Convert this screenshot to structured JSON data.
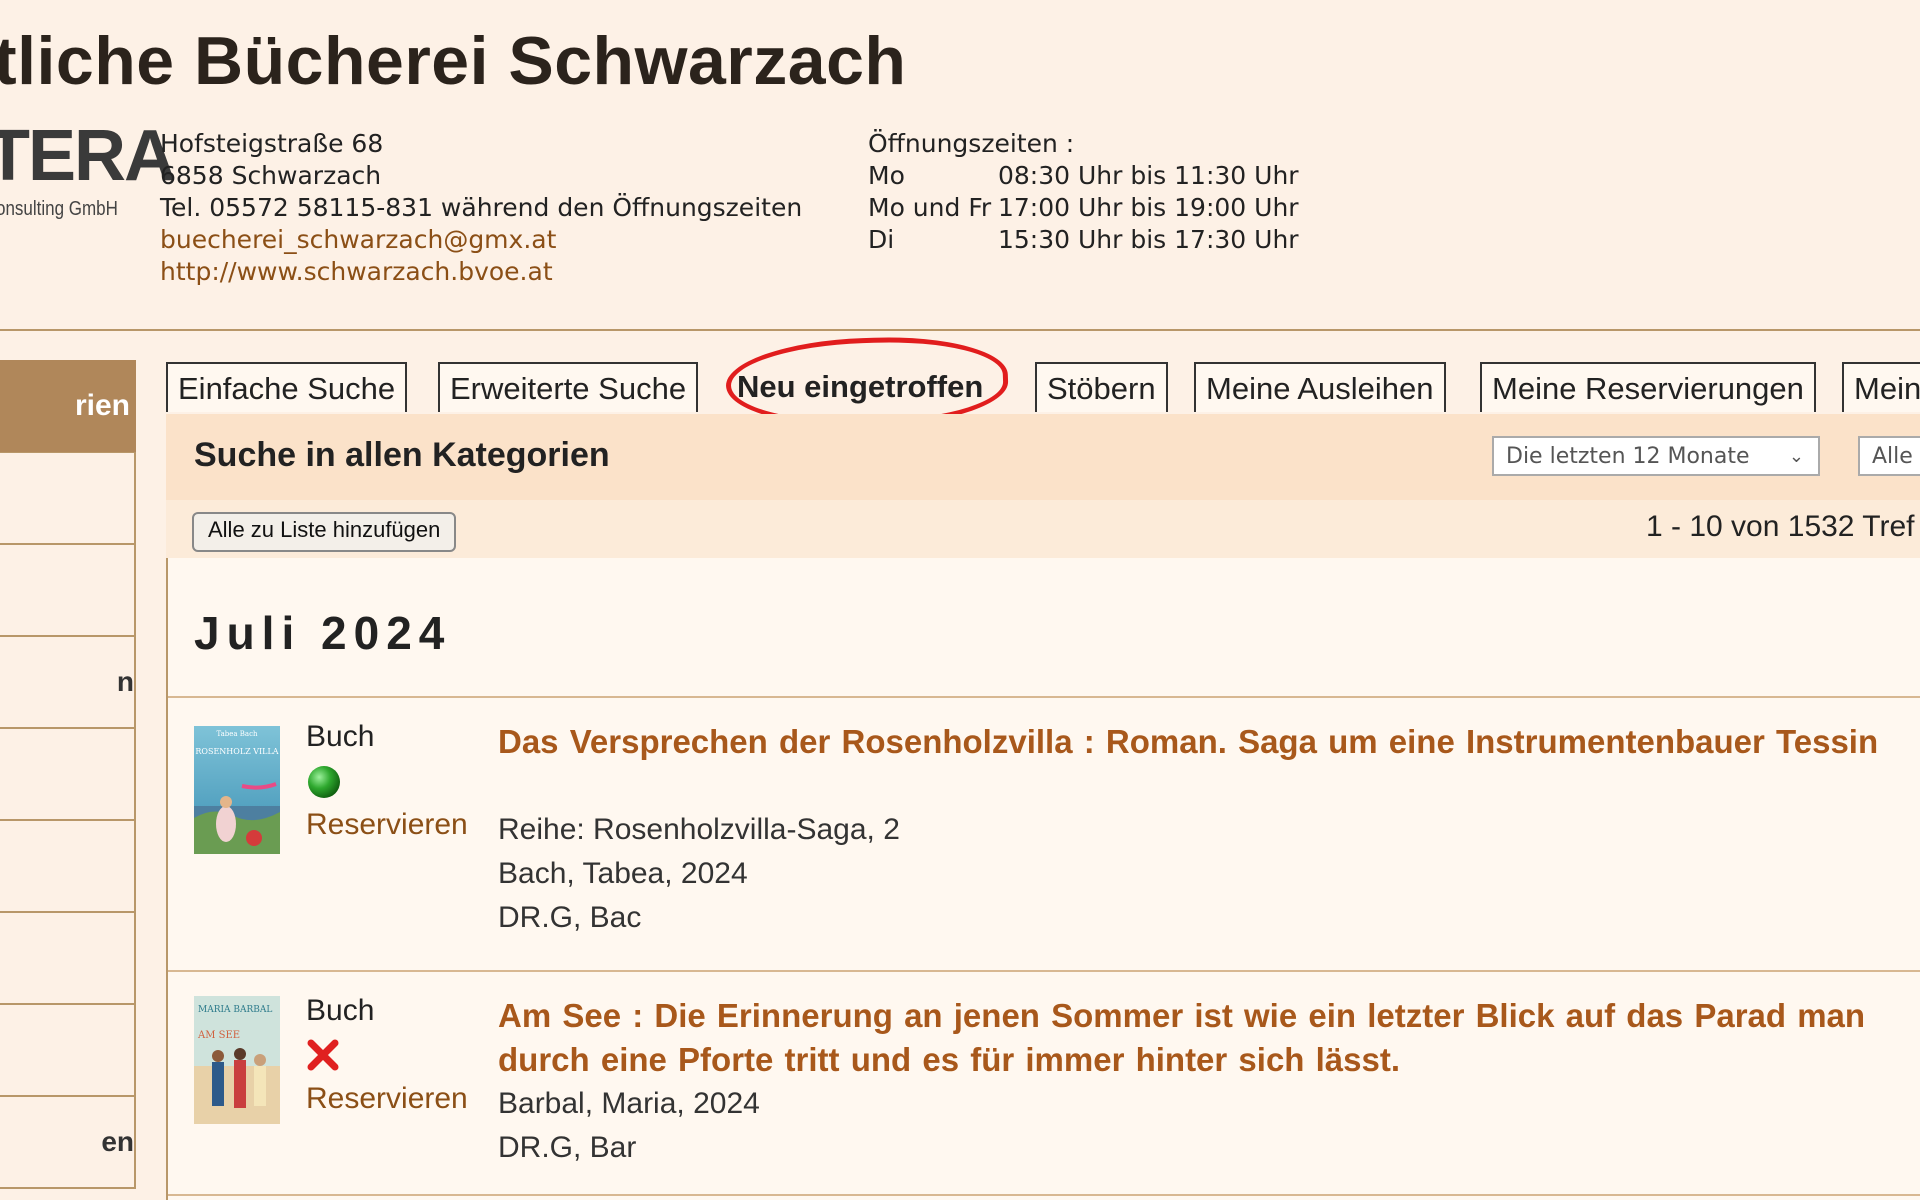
{
  "header": {
    "title": "tliche Bücherei Schwarzach",
    "logo_text": "TERA",
    "logo_sub": "onsulting GmbH",
    "address": {
      "street": "Hofsteigstraße 68",
      "city": "6858 Schwarzach",
      "phone": "Tel. 05572 58115-831 während den Öffnungszeiten",
      "email": "buecherei_schwarzach@gmx.at",
      "website": "http://www.schwarzach.bvoe.at"
    },
    "hours": {
      "label": "Öffnungszeiten :",
      "rows": [
        {
          "day": "Mo",
          "time": "08:30 Uhr bis 11:30 Uhr"
        },
        {
          "day": "Mo und Fr",
          "time": "17:00 Uhr bis 19:00 Uhr"
        },
        {
          "day": "Di",
          "time": "15:30 Uhr bis 17:30 Uhr"
        }
      ]
    }
  },
  "sidebar": {
    "heading": "rien",
    "items": [
      "",
      "",
      "n",
      "",
      "",
      "",
      "",
      "en"
    ]
  },
  "tabs": [
    {
      "label": "Einfache Suche"
    },
    {
      "label": "Erweiterte Suche"
    },
    {
      "label": "Neu eingetroffen"
    },
    {
      "label": "Stöbern"
    },
    {
      "label": "Meine Ausleihen"
    },
    {
      "label": "Meine Reservierungen"
    },
    {
      "label": "Mein"
    }
  ],
  "search": {
    "label": "Suche in allen Kategorien",
    "period": "Die letzten 12 Monate",
    "category": "Alle"
  },
  "actions": {
    "add_all": "Alle zu Liste hinzufügen",
    "count": "1 - 10 von 1532 Tref"
  },
  "results": {
    "month": "Juli 2024",
    "items": [
      {
        "type": "Buch",
        "status": "available",
        "reserve": "Reservieren",
        "title": "Das Versprechen der Rosenholzvilla : Roman. Saga um eine Instrumentenbauer Tessin",
        "series": "Reihe: Rosenholzvilla-Saga, 2",
        "author_year": "Bach, Tabea, 2024",
        "signature": "DR.G, Bac",
        "cover_author": "Tabea Bach",
        "cover_title": "ROSENHOLZ VILLA"
      },
      {
        "type": "Buch",
        "status": "unavailable",
        "reserve": "Reservieren",
        "title": "Am See : Die Erinnerung an jenen Sommer ist wie ein letzter Blick auf das Parad man durch eine Pforte tritt und es für immer hinter sich lässt.",
        "author_year": "Barbal, Maria, 2024",
        "signature": "DR.G, Bar",
        "cover_author": "MARIA BARBAL",
        "cover_title": "AM SEE"
      }
    ]
  },
  "colors": {
    "background": "#fdf1e6",
    "accent": "#b0875a",
    "link": "#a8581b",
    "highlight_circle": "#e11d1d",
    "available": "#2ea82e",
    "unavailable": "#e02020"
  }
}
